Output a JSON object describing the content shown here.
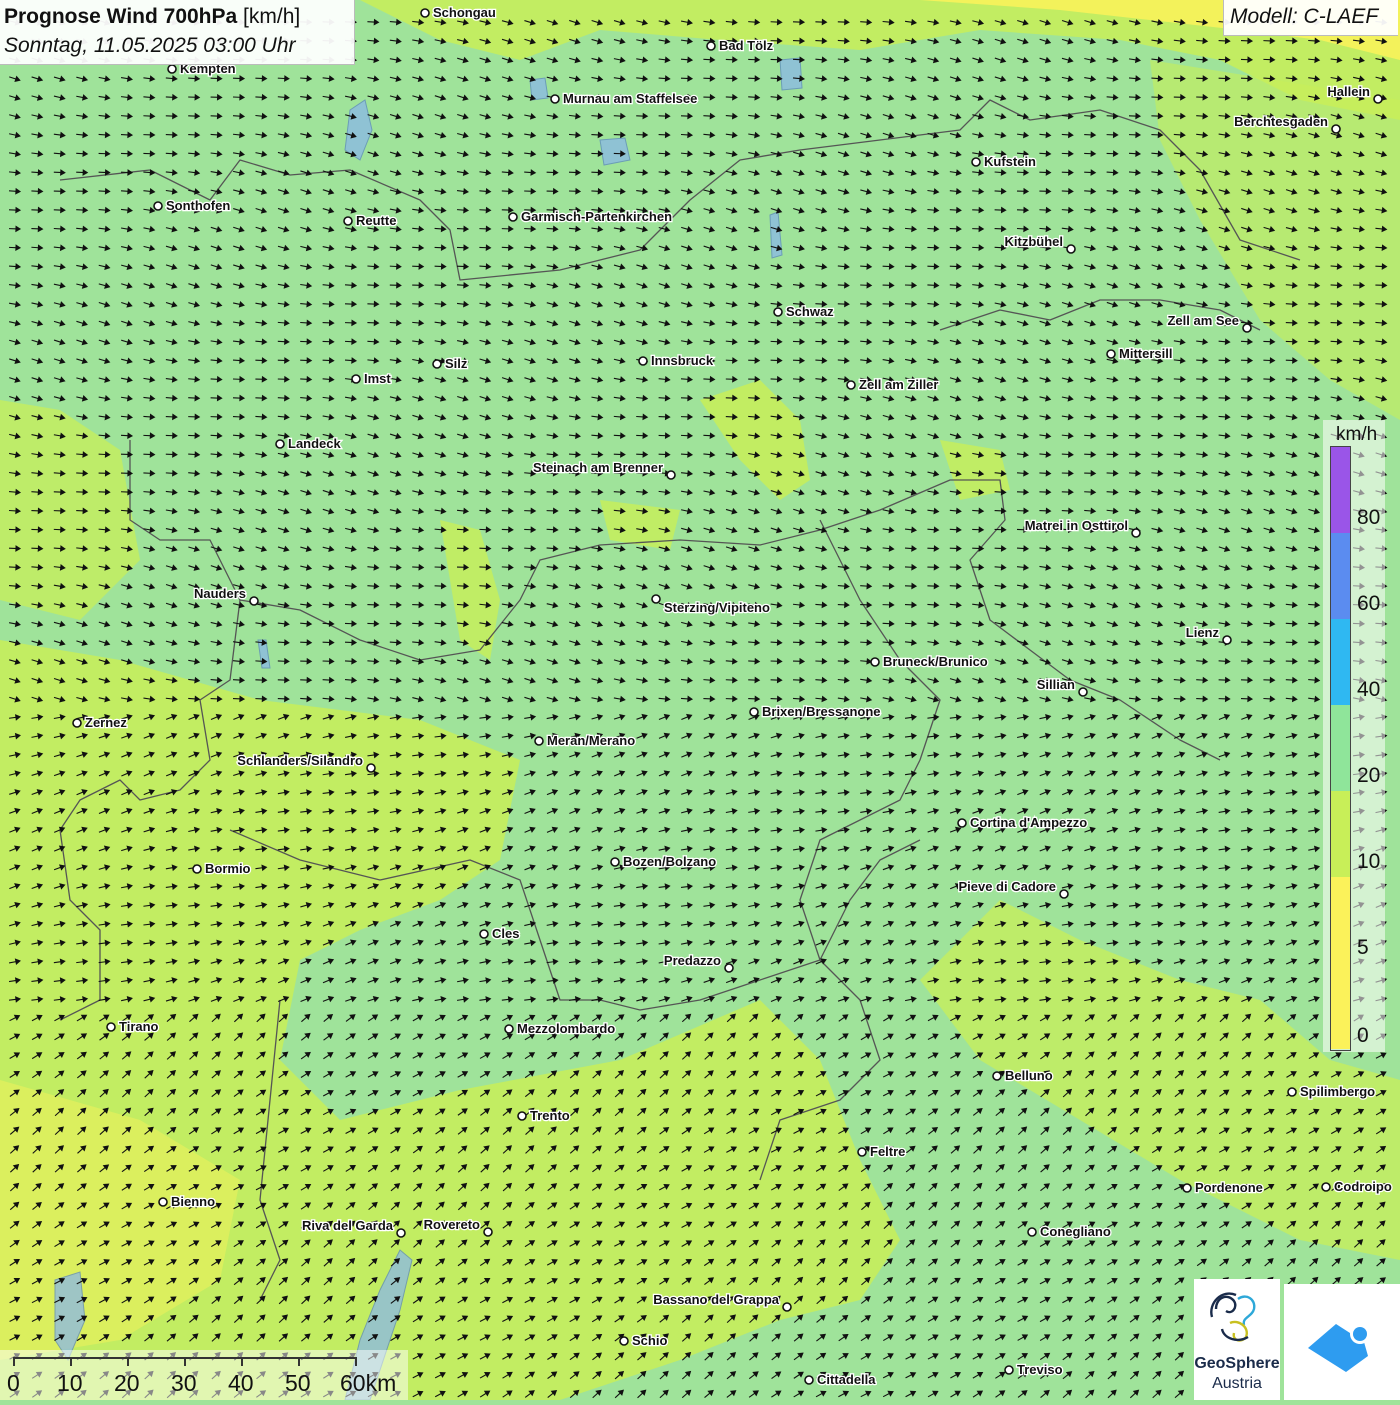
{
  "header": {
    "title": "Prognose Wind 700hPa",
    "unit": "[km/h]",
    "datetime": "Sonntag, 11.05.2025 03:00 Uhr",
    "model": "Modell: C-LAEF"
  },
  "legend": {
    "unit": "km/h",
    "ticks": [
      "80",
      "60",
      "40",
      "20",
      "10",
      "5",
      "0"
    ],
    "colors": [
      "#e3e3e3",
      "#f23a3a",
      "#9a55e8",
      "#5b8cf0",
      "#2fb8f2",
      "#8fe59a",
      "#c8ef58",
      "#fbf25a"
    ]
  },
  "scalebar": {
    "labels": [
      "0",
      "10",
      "20",
      "30",
      "40",
      "50",
      "60km"
    ]
  },
  "logo": {
    "line1": "GeoSphere",
    "line2": "Austria"
  },
  "colors": {
    "calm": "#fbf25a",
    "light": "#c8ef58",
    "moderate": "#9fe39a",
    "border": "#555555",
    "lake": "#8ab8e8"
  },
  "cities": [
    {
      "name": "Schongau"
    },
    {
      "name": "Bad Tölz"
    },
    {
      "name": "Kempten"
    },
    {
      "name": "Murnau am Staffelsee"
    },
    {
      "name": "Hallein"
    },
    {
      "name": "Berchtesgaden"
    },
    {
      "name": "Kufstein"
    },
    {
      "name": "Sonthofen"
    },
    {
      "name": "Reutte"
    },
    {
      "name": "Garmisch-Partenkirchen"
    },
    {
      "name": "Kitzbühel"
    },
    {
      "name": "Schwaz"
    },
    {
      "name": "Zell am See"
    },
    {
      "name": "Mittersill"
    },
    {
      "name": "Silz"
    },
    {
      "name": "Innsbruck"
    },
    {
      "name": "Imst"
    },
    {
      "name": "Zell am Ziller"
    },
    {
      "name": "Landeck"
    },
    {
      "name": "Steinach am Brenner"
    },
    {
      "name": "Matrei in Osttirol"
    },
    {
      "name": "Nauders"
    },
    {
      "name": "Sterzing/Vipiteno"
    },
    {
      "name": "Lienz"
    },
    {
      "name": "Bruneck/Brunico"
    },
    {
      "name": "Sillian"
    },
    {
      "name": "Zernez"
    },
    {
      "name": "Brixen/Bressanone"
    },
    {
      "name": "Meran/Merano"
    },
    {
      "name": "Schlanders/Silandro"
    },
    {
      "name": "Cortina d'Ampezzo"
    },
    {
      "name": "Bozen/Bolzano"
    },
    {
      "name": "Bormio"
    },
    {
      "name": "Pieve di Cadore"
    },
    {
      "name": "Cles"
    },
    {
      "name": "Predazzo"
    },
    {
      "name": "Tirano"
    },
    {
      "name": "Mezzolombardo"
    },
    {
      "name": "Belluno"
    },
    {
      "name": "Spilimbergo"
    },
    {
      "name": "Trento"
    },
    {
      "name": "Feltre"
    },
    {
      "name": "Pordenone"
    },
    {
      "name": "Codroipo"
    },
    {
      "name": "Bienno"
    },
    {
      "name": "Riva del Garda"
    },
    {
      "name": "Rovereto"
    },
    {
      "name": "Conegliano"
    },
    {
      "name": "Bassano del Grappa"
    },
    {
      "name": "Schio"
    },
    {
      "name": "Treviso"
    },
    {
      "name": "Cittadella"
    }
  ]
}
